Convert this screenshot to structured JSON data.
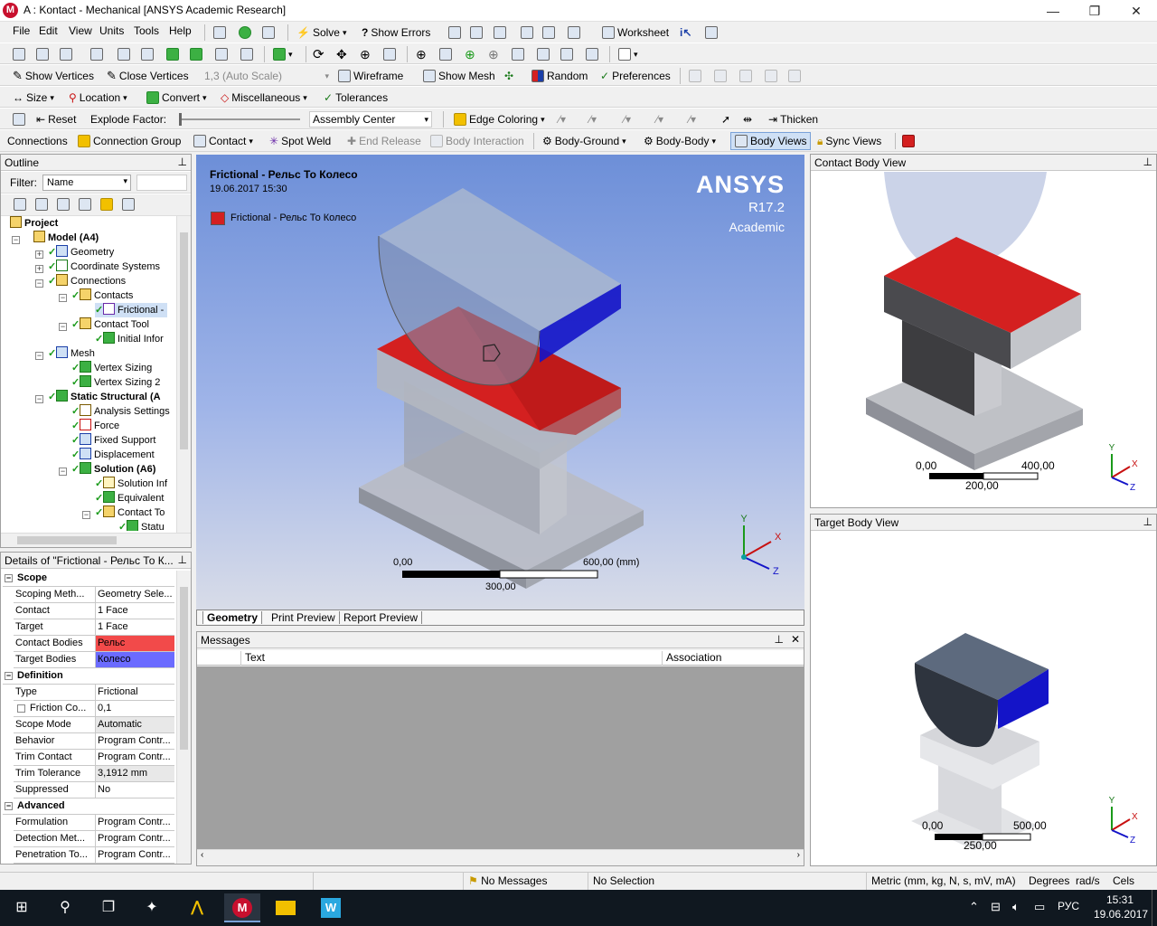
{
  "window": {
    "title": "A : Kontact - Mechanical [ANSYS Academic Research]",
    "min": "—",
    "max": "❐",
    "close": "✕"
  },
  "menu": [
    "File",
    "Edit",
    "View",
    "Units",
    "Tools",
    "Help"
  ],
  "toolbar1": {
    "solve": "Solve",
    "show_errors": "Show Errors",
    "worksheet": "Worksheet"
  },
  "toolbar3": {
    "show_vertices": "Show Vertices",
    "close_vertices": "Close Vertices",
    "auto_scale": "1,3 (Auto Scale)",
    "wireframe": "Wireframe",
    "show_mesh": "Show Mesh",
    "random": "Random",
    "preferences": "Preferences"
  },
  "toolbar4": {
    "size": "Size",
    "location": "Location",
    "convert": "Convert",
    "misc": "Miscellaneous",
    "tolerances": "Tolerances"
  },
  "toolbar5": {
    "reset": "Reset",
    "explode_factor": "Explode Factor:",
    "assembly_center": "Assembly Center",
    "edge_coloring": "Edge Coloring",
    "thicken": "Thicken"
  },
  "toolbar6": {
    "connections": "Connections",
    "connection_group": "Connection Group",
    "contact": "Contact",
    "spot_weld": "Spot Weld",
    "end_release": "End Release",
    "body_interaction": "Body Interaction",
    "body_ground": "Body-Ground",
    "body_body": "Body-Body",
    "body_views": "Body Views",
    "sync_views": "Sync Views"
  },
  "outline": {
    "title": "Outline",
    "filter_label": "Filter:",
    "filter_value": "Name",
    "items": [
      {
        "label": "Project",
        "bold": true
      },
      {
        "label": "Model (A4)",
        "bold": true
      },
      {
        "label": "Geometry"
      },
      {
        "label": "Coordinate Systems"
      },
      {
        "label": "Connections"
      },
      {
        "label": "Contacts"
      },
      {
        "label": "Frictional -"
      },
      {
        "label": "Contact Tool"
      },
      {
        "label": "Initial Infor"
      },
      {
        "label": "Mesh"
      },
      {
        "label": "Vertex Sizing"
      },
      {
        "label": "Vertex Sizing 2"
      },
      {
        "label": "Static Structural (A",
        "bold": true
      },
      {
        "label": "Analysis Settings"
      },
      {
        "label": "Force"
      },
      {
        "label": "Fixed Support"
      },
      {
        "label": "Displacement"
      },
      {
        "label": "Solution (A6)",
        "bold": true
      },
      {
        "label": "Solution Inf"
      },
      {
        "label": "Equivalent"
      },
      {
        "label": "Contact To"
      },
      {
        "label": "Statu"
      }
    ]
  },
  "details": {
    "title": "Details of \"Frictional - Рельс То К...",
    "scope": "Scope",
    "definition": "Definition",
    "advanced": "Advanced",
    "rows_scope": [
      {
        "k": "Scoping Meth...",
        "v": "Geometry Sele..."
      },
      {
        "k": "Contact",
        "v": "1 Face"
      },
      {
        "k": "Target",
        "v": "1 Face"
      },
      {
        "k": "Contact Bodies",
        "v": "Рельс",
        "color": "#f24a4a"
      },
      {
        "k": "Target Bodies",
        "v": "Колесо",
        "color": "#6b6bff"
      }
    ],
    "rows_def": [
      {
        "k": "Type",
        "v": "Frictional"
      },
      {
        "k": "Friction Co...",
        "v": "0,1"
      },
      {
        "k": "Scope Mode",
        "v": "Automatic"
      },
      {
        "k": "Behavior",
        "v": "Program Contr..."
      },
      {
        "k": "Trim Contact",
        "v": "Program Contr..."
      },
      {
        "k": "Trim Tolerance",
        "v": "3,1912 mm"
      },
      {
        "k": "Suppressed",
        "v": "No"
      }
    ],
    "rows_adv": [
      {
        "k": "Formulation",
        "v": "Program Contr..."
      },
      {
        "k": "Detection Met...",
        "v": "Program Contr..."
      },
      {
        "k": "Penetration To...",
        "v": "Program Contr..."
      }
    ]
  },
  "viewport": {
    "title": "Frictional - Рельс То Колесо",
    "date": "19.06.2017 15:30",
    "legend": "Frictional - Рельс То Колесо",
    "brand": "ANSYS",
    "version": "R17.2",
    "edition": "Academic",
    "scale_left": "0,00",
    "scale_right": "600,00 (mm)",
    "scale_mid": "300,00",
    "tabs": [
      "Geometry",
      "Print Preview",
      "Report Preview"
    ]
  },
  "messages": {
    "title": "Messages",
    "col_text": "Text",
    "col_assoc": "Association"
  },
  "contact_view": {
    "title": "Contact Body View",
    "scale_left": "0,00",
    "scale_right": "400,00",
    "scale_mid": "200,00"
  },
  "target_view": {
    "title": "Target Body View",
    "scale_left": "0,00",
    "scale_right": "500,00",
    "scale_mid": "250,00"
  },
  "status": {
    "messages": "No Messages",
    "selection": "No Selection",
    "units": "Metric (mm, kg, N, s, mV, mA)",
    "degrees": "Degrees",
    "rads": "rad/s",
    "cels": "Cels"
  },
  "taskbar": {
    "lang": "РУС",
    "time": "15:31",
    "date": "19.06.2017"
  },
  "colors": {
    "contact_red": "#d42020",
    "target_blue": "#1414c8",
    "accent": "#3c5aa8"
  }
}
